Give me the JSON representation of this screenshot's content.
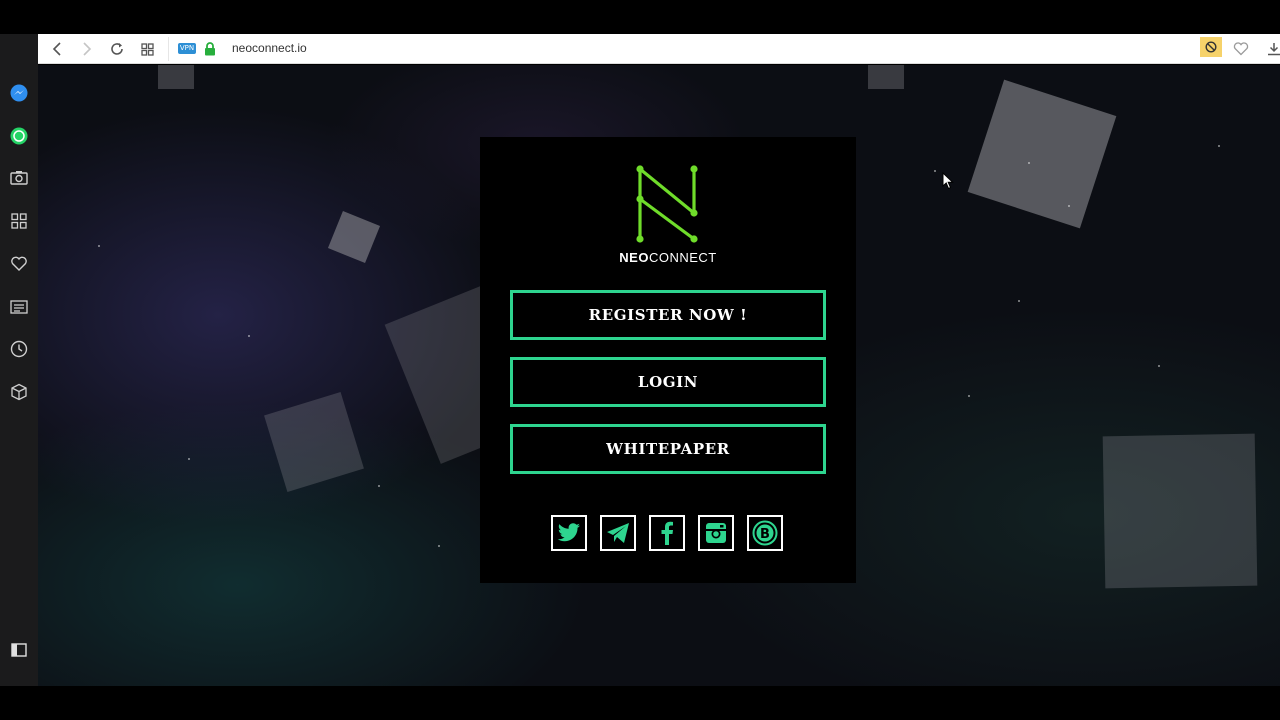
{
  "browser": {
    "url": "neoconnect.io",
    "vpn_label": "VPN"
  },
  "sidebar": {
    "icons": [
      "messenger-icon",
      "whatsapp-icon",
      "camera-icon",
      "speed-dial-icon",
      "heart-icon",
      "news-icon",
      "history-icon",
      "extensions-icon",
      "sidebar-toggle-icon"
    ]
  },
  "page": {
    "logo_bold": "NEO",
    "logo_light": "CONNECT",
    "buttons": {
      "register": "REGISTER NOW !",
      "login": "LOGIN",
      "whitepaper": "WHITEPAPER"
    },
    "socials": [
      "twitter-icon",
      "telegram-icon",
      "facebook-icon",
      "instagram-icon",
      "bitcoin-icon"
    ]
  },
  "colors": {
    "accent": "#2ed58f",
    "logo_green": "#6fdc2a",
    "card": "#000000"
  }
}
